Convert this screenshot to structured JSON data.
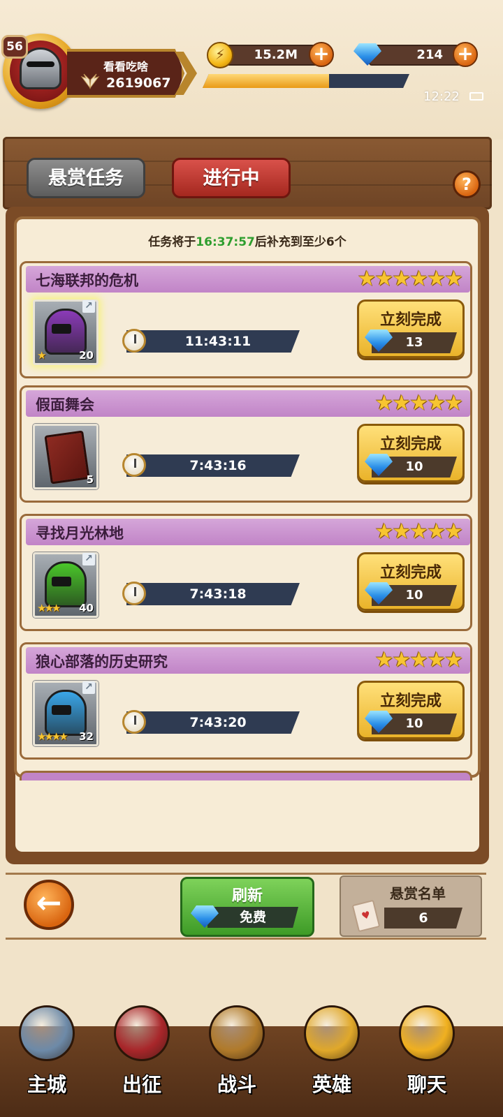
{
  "player": {
    "level": "56",
    "name": "看看吃啥",
    "score": "2619067"
  },
  "resources": {
    "gold": "15.2M",
    "gems": "214",
    "xp_progress": 0.61
  },
  "status_bar": {
    "time": "12:22"
  },
  "tabs": {
    "bounty": "悬赏任务",
    "in_progress": "进行中",
    "help": "?"
  },
  "refill_notice": {
    "prefix": "任务将于",
    "time": "16:37:57",
    "suffix": "后补充到至少6个"
  },
  "quests": [
    {
      "title": "七海联邦的危机",
      "stars": 6,
      "timer": "11:43:11",
      "button": "立刻完成",
      "cost": "13",
      "item": {
        "type": "helmet",
        "color": "#8b3bb8",
        "count": "20",
        "item_stars": 1
      }
    },
    {
      "title": "假面舞会",
      "stars": 5,
      "timer": "7:43:16",
      "button": "立刻完成",
      "cost": "10",
      "item": {
        "type": "book",
        "color": "#8e2b22",
        "count": "5",
        "item_stars": 0
      }
    },
    {
      "title": "寻找月光林地",
      "stars": 5,
      "timer": "7:43:18",
      "button": "立刻完成",
      "cost": "10",
      "item": {
        "type": "helmet",
        "color": "#4ac62a",
        "count": "40",
        "item_stars": 3
      }
    },
    {
      "title": "狼心部落的历史研究",
      "stars": 5,
      "timer": "7:43:20",
      "button": "立刻完成",
      "cost": "10",
      "item": {
        "type": "helmet",
        "color": "#3aa6e8",
        "count": "32",
        "item_stars": 4
      }
    }
  ],
  "actions": {
    "back": "←",
    "refresh_label": "刷新",
    "refresh_cost": "免费",
    "bounty_list_label": "悬赏名单",
    "bounty_list_count": "6"
  },
  "nav": [
    {
      "label": "主城",
      "icon": "castle-tower-icon",
      "color": "#6d8aa8"
    },
    {
      "label": "出征",
      "icon": "expedition-icon",
      "color": "#a8262a"
    },
    {
      "label": "战斗",
      "icon": "battle-shield-icon",
      "color": "#b07a2a"
    },
    {
      "label": "英雄",
      "icon": "hero-helmet-icon",
      "color": "#e0a82a"
    },
    {
      "label": "聊天",
      "icon": "chat-bubble-icon",
      "color": "#f0b020"
    }
  ]
}
